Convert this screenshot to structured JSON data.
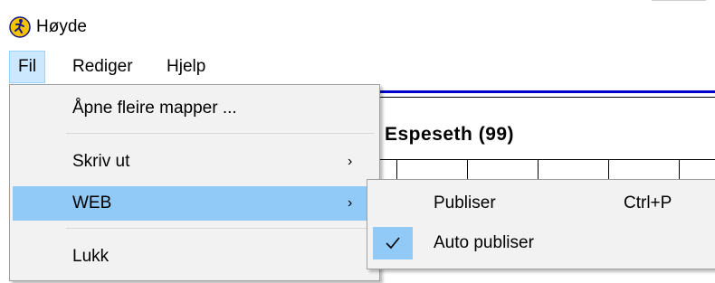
{
  "window": {
    "title": "Høyde"
  },
  "menubar": {
    "items": [
      "Fil",
      "Rediger",
      "Hjelp"
    ]
  },
  "document": {
    "heading": "Espeseth (99)"
  },
  "file_menu": {
    "items": [
      {
        "label": "Åpne fleire mapper ..."
      },
      {
        "label": "Skriv ut",
        "submenu_arrow": "›"
      },
      {
        "label": "WEB",
        "submenu_arrow": "›"
      },
      {
        "label": "Lukk"
      }
    ]
  },
  "web_submenu": {
    "items": [
      {
        "label": "Publiser",
        "shortcut": "Ctrl+P",
        "checked": false
      },
      {
        "label": "Auto publiser",
        "shortcut": "",
        "checked": true
      }
    ]
  },
  "colors": {
    "highlight": "#91c9f7",
    "menubar_active": "#cce8ff",
    "rule": "#0000c8"
  }
}
